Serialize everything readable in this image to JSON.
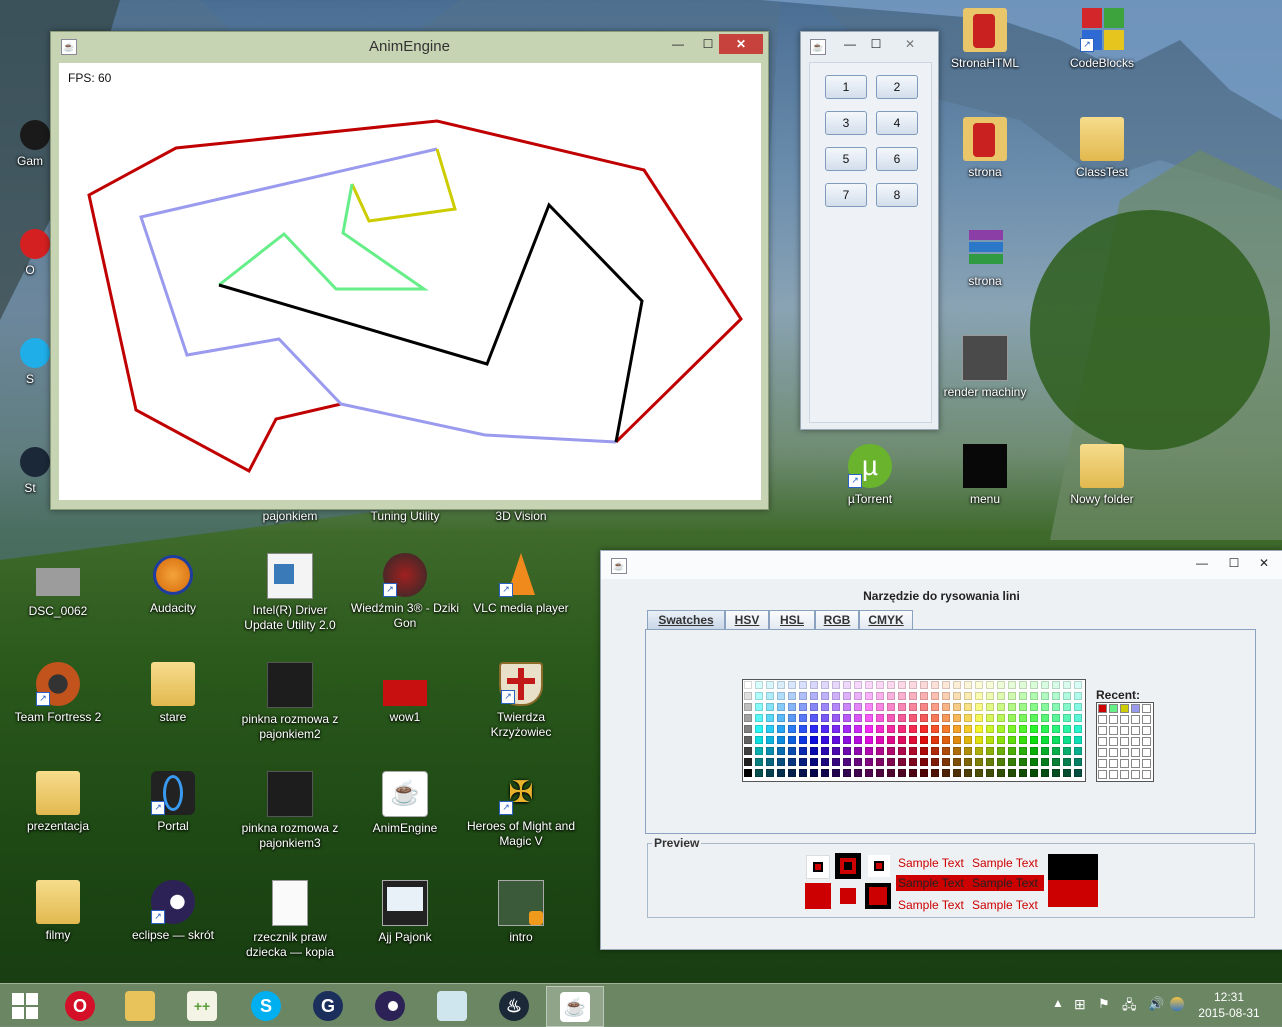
{
  "desktop": {
    "icons": [
      {
        "label": "StronaHTML",
        "glyph": "folder-icon"
      },
      {
        "label": "CodeBlocks",
        "glyph": "codeblocks-icon"
      },
      {
        "label": "strona",
        "glyph": "folder-icon"
      },
      {
        "label": "ClassTest",
        "glyph": "folder-icon"
      },
      {
        "label": "strona",
        "glyph": "winrar-icon"
      },
      {
        "label": "render machiny",
        "glyph": "image-icon"
      },
      {
        "label": "µTorrent",
        "glyph": "utorrent-icon"
      },
      {
        "label": "menu",
        "glyph": "image-icon"
      },
      {
        "label": "Nowy folder",
        "glyph": "folder-icon"
      },
      {
        "label": "pajonkiem",
        "glyph": "file-icon"
      },
      {
        "label": "Tuning Utility",
        "glyph": "app-icon"
      },
      {
        "label": "3D Vision",
        "glyph": "app-icon"
      },
      {
        "label": "DSC_0062",
        "glyph": "image-icon"
      },
      {
        "label": "Audacity",
        "glyph": "audacity-icon"
      },
      {
        "label": "Intel(R) Driver Update Utility 2.0",
        "glyph": "intel-icon"
      },
      {
        "label": "Wiedźmin 3® - Dziki Gon",
        "glyph": "witcher-icon"
      },
      {
        "label": "VLC media player",
        "glyph": "vlc-icon"
      },
      {
        "label": "Team Fortress 2",
        "glyph": "tf2-icon"
      },
      {
        "label": "stare",
        "glyph": "folder-icon"
      },
      {
        "label": "pinkna rozmowa z pajonkiem2",
        "glyph": "image-icon"
      },
      {
        "label": "wow1",
        "glyph": "image-icon"
      },
      {
        "label": "Twierdza Krzyżowiec",
        "glyph": "shield-icon"
      },
      {
        "label": "prezentacja",
        "glyph": "folder-icon"
      },
      {
        "label": "Portal",
        "glyph": "portal-icon"
      },
      {
        "label": "pinkna rozmowa z pajonkiem3",
        "glyph": "image-icon"
      },
      {
        "label": "AnimEngine",
        "glyph": "java-icon"
      },
      {
        "label": "Heroes of Might and Magic V",
        "glyph": "heroes-icon"
      },
      {
        "label": "filmy",
        "glyph": "folder-icon"
      },
      {
        "label": "eclipse — skrót",
        "glyph": "eclipse-icon"
      },
      {
        "label": "rzecznik praw dziecka — kopia",
        "glyph": "text-file-icon"
      },
      {
        "label": "Ajj Pajonk",
        "glyph": "image-icon"
      },
      {
        "label": "intro",
        "glyph": "video-icon"
      },
      {
        "label": "Gam",
        "glyph": "app-icon"
      },
      {
        "label": "O",
        "glyph": "app-icon"
      },
      {
        "label": "S",
        "glyph": "app-icon"
      },
      {
        "label": "St",
        "glyph": "app-icon"
      }
    ]
  },
  "anim_window": {
    "title": "AnimEngine",
    "fps_label": "FPS: 60",
    "minimize": "—",
    "maximize": "☐",
    "close": "✕"
  },
  "buttons_window": {
    "buttons": [
      "1",
      "2",
      "3",
      "4",
      "5",
      "6",
      "7",
      "8"
    ],
    "minimize": "—",
    "maximize": "☐",
    "close": "✕"
  },
  "color_tool": {
    "heading": "Narzędzie do rysowania lini",
    "tabs": [
      "Swatches",
      "HSV",
      "HSL",
      "RGB",
      "CMYK"
    ],
    "active_tab": "Swatches",
    "recent_label": "Recent:",
    "recent_colors": [
      "#cc0000",
      "#66ee88",
      "#cccc00",
      "#9999ee"
    ],
    "preview_label": "Preview",
    "sample_text": "Sample Text",
    "minimize": "—",
    "maximize": "☐",
    "close": "✕"
  },
  "taskbar": {
    "apps": [
      "opera-icon",
      "file-explorer-icon",
      "notepad-plus-plus-icon",
      "skype-icon",
      "cpu-z-icon",
      "eclipse-icon",
      "notes-icon",
      "steam-icon",
      "java-icon"
    ],
    "time": "12:31",
    "date": "2015-08-31"
  },
  "colors": {
    "red_line": "#c00000",
    "blue_line": "#9a9aee",
    "yellow_line": "#cccc00",
    "green_line": "#66ee88",
    "black_line": "#000000"
  }
}
